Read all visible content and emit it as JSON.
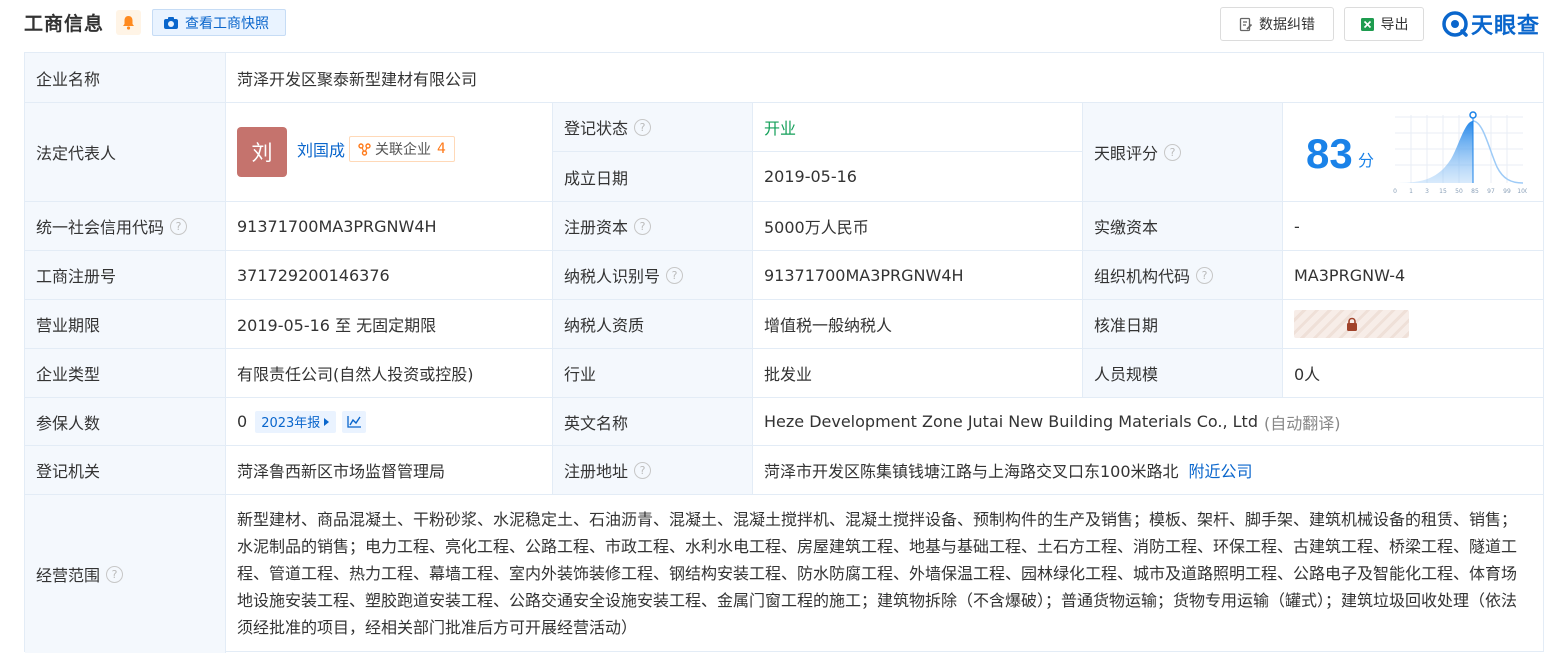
{
  "header": {
    "title": "工商信息",
    "snapshot_button": "查看工商快照",
    "correct_button": "数据纠错",
    "export_button": "导出",
    "logo_text": "天眼查"
  },
  "company": {
    "name_label": "企业名称",
    "name": "菏泽开发区聚泰新型建材有限公司",
    "rep_label": "法定代表人",
    "rep_avatar": "刘",
    "rep_name": "刘国成",
    "rel_label": "关联企业",
    "rel_count": "4",
    "status_label": "登记状态",
    "status": "开业",
    "found_label": "成立日期",
    "found_date": "2019-05-16",
    "score_label": "天眼评分",
    "score": "83",
    "score_unit": "分",
    "score_axis": [
      "0",
      "1",
      "3",
      "15",
      "50",
      "85",
      "97",
      "99",
      "100"
    ],
    "credit_label": "统一社会信用代码",
    "credit_code": "91371700MA3PRGNW4H",
    "capital_label": "注册资本",
    "capital": "5000万人民币",
    "paid_label": "实缴资本",
    "paid": "-",
    "regno_label": "工商注册号",
    "regno": "371729200146376",
    "taxid_label": "纳税人识别号",
    "taxid": "91371700MA3PRGNW4H",
    "org_label": "组织机构代码",
    "org_code": "MA3PRGNW-4",
    "term_label": "营业期限",
    "term": "2019-05-16 至 无固定期限",
    "taxq_label": "纳税人资质",
    "taxq": "增值税一般纳税人",
    "approve_label": "核准日期",
    "type_label": "企业类型",
    "type": "有限责任公司(自然人投资或控股)",
    "industry_label": "行业",
    "industry": "批发业",
    "staff_label": "人员规模",
    "staff": "0人",
    "insured_label": "参保人数",
    "insured": "0",
    "report_year": "2023年报",
    "en_label": "英文名称",
    "en_name": "Heze Development Zone Jutai New Building Materials Co., Ltd",
    "en_note": "(自动翻译)",
    "authority_label": "登记机关",
    "authority": "菏泽鲁西新区市场监督管理局",
    "address_label": "注册地址",
    "address": "菏泽市开发区陈集镇钱塘江路与上海路交叉口东100米路北",
    "nearby_link": "附近公司",
    "scope_label": "经营范围",
    "scope": "新型建材、商品混凝土、干粉砂浆、水泥稳定土、石油沥青、混凝土、混凝土搅拌机、混凝土搅拌设备、预制构件的生产及销售；模板、架杆、脚手架、建筑机械设备的租赁、销售；水泥制品的销售；电力工程、亮化工程、公路工程、市政工程、水利水电工程、房屋建筑工程、地基与基础工程、土石方工程、消防工程、环保工程、古建筑工程、桥梁工程、隧道工程、管道工程、热力工程、幕墙工程、室内外装饰装修工程、钢结构安装工程、防水防腐工程、外墙保温工程、园林绿化工程、城市及道路照明工程、公路电子及智能化工程、体育场地设施安装工程、塑胶跑道安装工程、公路交通安全设施安装工程、金属门窗工程的施工；建筑物拆除（不含爆破）；普通货物运输；货物专用运输（罐式）；建筑垃圾回收处理（依法须经批准的项目，经相关部门批准后方可开展经营活动）"
  },
  "colors": {
    "brand": "#0a66cc",
    "status_green": "#14a05a",
    "label_bg": "#f4f8fd",
    "border": "#e3ecf6",
    "avatar_bg": "#c5736d",
    "tag_orange": "#ff7a1a"
  },
  "icons": [
    "bell-icon",
    "camera-icon",
    "correct-icon",
    "excel-icon",
    "logo-icon",
    "help-icon",
    "relation-icon",
    "lock-icon",
    "trend-icon",
    "caret-right-icon"
  ]
}
